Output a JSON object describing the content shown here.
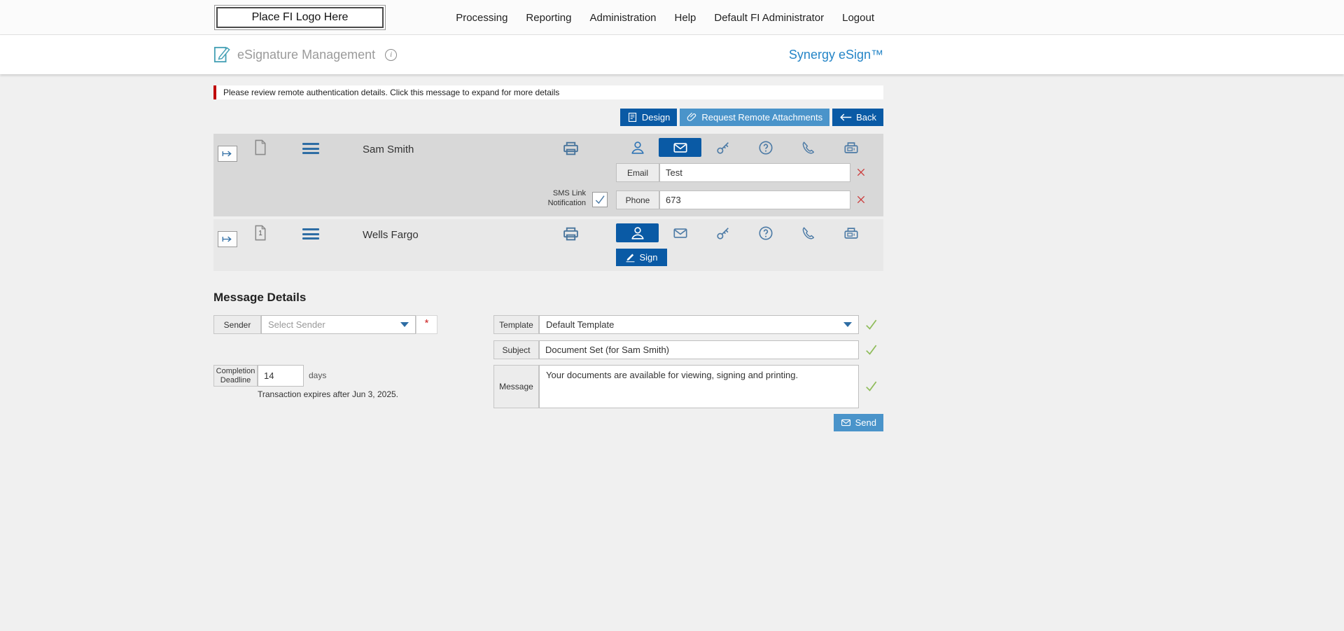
{
  "colors": {
    "primary_blue": "#0a5aa5",
    "light_blue": "#4a94ca",
    "brand_blue": "#2585c7",
    "alert_red": "#c00000",
    "error_red": "#cc3a3a",
    "success_green": "#8fbc5a",
    "row_sam_bg": "#d8d8d8",
    "row_wells_bg": "#e8e8e8",
    "page_bg": "#f0f0f0"
  },
  "topnav": {
    "logo_placeholder": "Place FI Logo Here",
    "items": [
      "Processing",
      "Reporting",
      "Administration",
      "Help",
      "Default FI Administrator",
      "Logout"
    ]
  },
  "header": {
    "title": "eSignature Management",
    "brand": "Synergy eSign™"
  },
  "glyphs": {
    "info": "i"
  },
  "alert": {
    "message": "Please review remote authentication details. Click this message to expand for more details"
  },
  "toolbar": {
    "design": "Design",
    "request_remote_attachments": "Request Remote Attachments",
    "back": "Back"
  },
  "recipients": [
    {
      "name": "Sam Smith",
      "selected_delivery": "email",
      "email_label": "Email",
      "email_value": "Test",
      "sms_line1": "SMS Link",
      "sms_line2": "Notification",
      "sms_checked": true,
      "phone_label": "Phone",
      "phone_value": "673"
    },
    {
      "name": "Wells Fargo",
      "document_count": "1",
      "selected_delivery": "in-person",
      "sign_button": "Sign"
    }
  ],
  "message_details": {
    "heading": "Message Details",
    "sender": {
      "label": "Sender",
      "placeholder": "Select Sender",
      "required_marker": "*"
    },
    "completion_deadline": {
      "label_line1": "Completion",
      "label_line2": "Deadline",
      "value": "14",
      "unit": "days",
      "note": "Transaction expires after Jun 3, 2025."
    },
    "template": {
      "label": "Template",
      "value": "Default Template"
    },
    "subject": {
      "label": "Subject",
      "value": "Document Set (for Sam Smith)"
    },
    "message": {
      "label": "Message",
      "value": "Your documents are available for viewing, signing and printing."
    },
    "send": "Send"
  },
  "icons": {
    "esignature-icon": "document-with-pencil",
    "info-icon": "circled-i",
    "design-icon": "form-document",
    "paperclip-icon": "paperclip",
    "back-arrow-icon": "left-arrow",
    "signing-order-icon": "right-arrow",
    "document-icon": "page-outline",
    "drag-handle-icon": "hamburger-lines",
    "print-icon": "printer",
    "in-person-icon": "person",
    "email-delivery-icon": "envelope",
    "password-auth-icon": "key",
    "security-question-icon": "question-circle",
    "phone-auth-icon": "phone-handset",
    "fax-delivery-icon": "fax-machine",
    "sign-icon": "pen",
    "send-icon": "envelope",
    "valid-icon": "green-checkmark",
    "remove-icon": "red-x",
    "checkbox-check-icon": "checkmark",
    "chevron-down-icon": "triangle-down"
  }
}
